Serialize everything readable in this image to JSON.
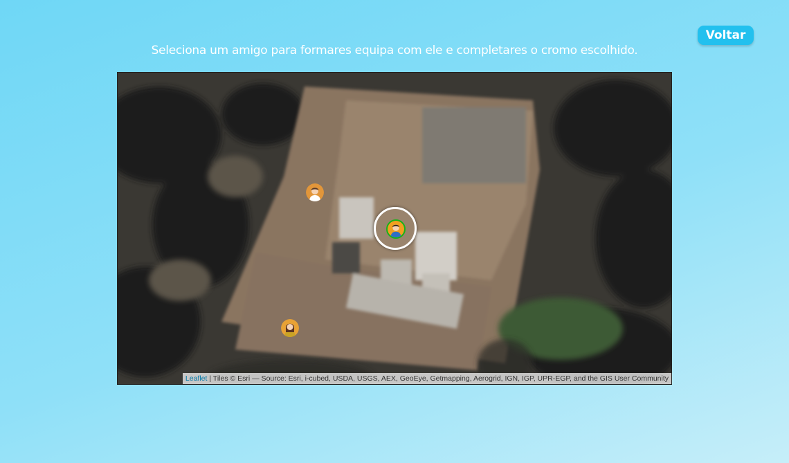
{
  "header": {
    "back_label": "Voltar",
    "instruction": "Seleciona um amigo para formares equipa com ele e completares o cromo escolhido."
  },
  "map": {
    "attribution_link": "Leaflet",
    "attribution_text": " | Tiles © Esri — Source: Esri, i-cubed, USDA, USGS, AEX, GeoEye, Getmapping, Aerogrid, IGN, IGP, UPR-EGP, and the GIS User Community",
    "markers": [
      {
        "name": "friend-marker-1",
        "icon": "person-avatar-icon",
        "accent": "#e2963a",
        "shirt": "#ffffff"
      },
      {
        "name": "current-user-marker",
        "icon": "person-avatar-icon",
        "accent": "#f0a020",
        "shirt": "#2f6fc6",
        "selected": true
      },
      {
        "name": "friend-marker-2",
        "icon": "person-avatar-icon",
        "accent": "#e8a235",
        "shirt": "#c9a325"
      }
    ]
  },
  "colors": {
    "back_button": "#22c0ee",
    "selected_ring": "#ffffff",
    "selected_border": "#18b318"
  }
}
